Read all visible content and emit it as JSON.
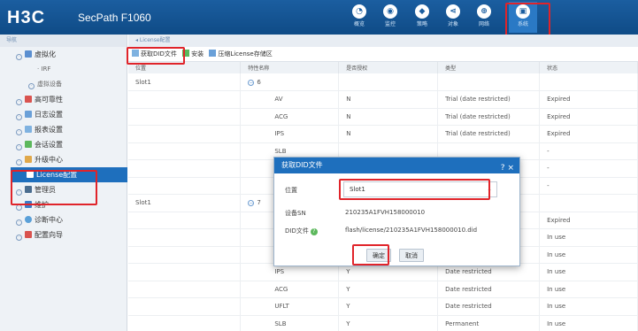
{
  "header": {
    "logo": "H3C",
    "product": "SecPath F1060",
    "nav": [
      {
        "label": "概览",
        "icon": "dashboard-icon"
      },
      {
        "label": "监控",
        "icon": "monitor-icon"
      },
      {
        "label": "策略",
        "icon": "policy-icon"
      },
      {
        "label": "对象",
        "icon": "object-icon"
      },
      {
        "label": "网络",
        "icon": "network-icon"
      },
      {
        "label": "系统",
        "icon": "system-icon"
      }
    ]
  },
  "sidebar": {
    "title": "导航",
    "items": [
      {
        "label": "虚拟化"
      },
      {
        "label": "IRF"
      },
      {
        "label": "虚拟设备"
      },
      {
        "label": "高可靠性"
      },
      {
        "label": "日志设置"
      },
      {
        "label": "报表设置"
      },
      {
        "label": "会话设置"
      },
      {
        "label": "升级中心"
      },
      {
        "label": "License配置"
      },
      {
        "label": "管理员"
      },
      {
        "label": "维护"
      },
      {
        "label": "诊断中心"
      },
      {
        "label": "配置向导"
      }
    ]
  },
  "breadcrumb": "License配置",
  "toolbar": {
    "get_did": "获取DID文件",
    "install": "安装",
    "compress": "压缩License存储区"
  },
  "table": {
    "headers": [
      "位置",
      "特性名称",
      "是否授权",
      "类型",
      "状态"
    ],
    "rows": [
      [
        "Slot1",
        "6",
        "",
        "",
        ""
      ],
      [
        "",
        "AV",
        "N",
        "Trial (date restricted)",
        "Expired"
      ],
      [
        "",
        "ACG",
        "N",
        "Trial (date restricted)",
        "Expired"
      ],
      [
        "",
        "IPS",
        "N",
        "Trial (date restricted)",
        "Expired"
      ],
      [
        "",
        "SLB",
        "",
        "",
        "-"
      ],
      [
        "",
        "SSL",
        "",
        "",
        "-"
      ],
      [
        "",
        "UFLT",
        "",
        "",
        "-"
      ],
      [
        "Slot1",
        "7",
        "",
        "",
        ""
      ],
      [
        "",
        "WAF",
        "",
        "",
        "Expired"
      ],
      [
        "",
        "SSL",
        "",
        "",
        "In use"
      ],
      [
        "",
        "AV",
        "",
        "",
        "In use"
      ],
      [
        "",
        "IPS",
        "Y",
        "Date restricted",
        "In use"
      ],
      [
        "",
        "ACG",
        "Y",
        "Date restricted",
        "In use"
      ],
      [
        "",
        "UFLT",
        "Y",
        "Date restricted",
        "In use"
      ],
      [
        "",
        "SLB",
        "Y",
        "Permanent",
        "In use"
      ]
    ]
  },
  "dialog": {
    "title": "获取DID文件",
    "close": "×",
    "location_label": "位置",
    "location_value": "Slot1",
    "sn_label": "设备SN",
    "sn_value": "210235A1FVH158000010",
    "did_label": "DID文件",
    "did_value": "flash/license/210235A1FVH158000010.did",
    "ok": "确定",
    "cancel": "取消"
  },
  "colors": {
    "header": "#1b5ea0",
    "active": "#1e6fbd",
    "highlight": "#e0242a"
  }
}
